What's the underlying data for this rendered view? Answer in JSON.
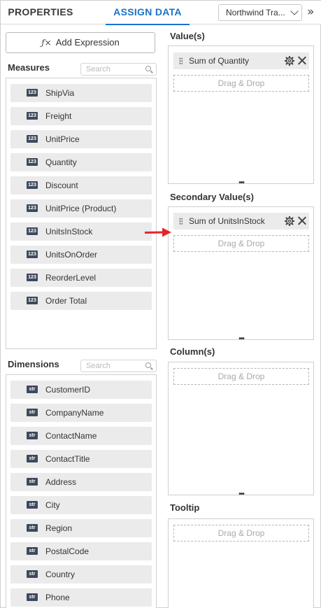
{
  "tabs": {
    "properties": "PROPERTIES",
    "assign_data": "ASSIGN DATA",
    "active": "assign_data"
  },
  "datasource": {
    "selected": "Northwind Tra..."
  },
  "collapse_icon": "double-chevron-right-icon",
  "left": {
    "add_expression_label": "Add Expression",
    "add_expression_icon": "fx-icon",
    "measures": {
      "title": "Measures",
      "search_placeholder": "Search",
      "badge": "123",
      "items": [
        "ShipVia",
        "Freight",
        "UnitPrice",
        "Quantity",
        "Discount",
        "UnitPrice (Product)",
        "UnitsInStock",
        "UnitsOnOrder",
        "ReorderLevel",
        "Order Total"
      ]
    },
    "dimensions": {
      "title": "Dimensions",
      "search_placeholder": "Search",
      "badge": "str",
      "items": [
        "CustomerID",
        "CompanyName",
        "ContactName",
        "ContactTitle",
        "Address",
        "City",
        "Region",
        "PostalCode",
        "Country",
        "Phone"
      ]
    }
  },
  "right": {
    "values": {
      "title": "Value(s)",
      "chip": "Sum of Quantity",
      "drop_label": "Drag & Drop"
    },
    "secondary_values": {
      "title": "Secondary Value(s)",
      "chip": "Sum of UnitsInStock",
      "drop_label": "Drag & Drop"
    },
    "columns": {
      "title": "Column(s)",
      "drop_label": "Drag & Drop"
    },
    "tooltip": {
      "title": "Tooltip",
      "drop_label": "Drag & Drop"
    },
    "resize_glyph": "•••"
  },
  "colors": {
    "accent": "#1a73c9",
    "badge": "#3d4a5c",
    "arrow": "#e3262a",
    "item_bg": "#ebebeb"
  }
}
